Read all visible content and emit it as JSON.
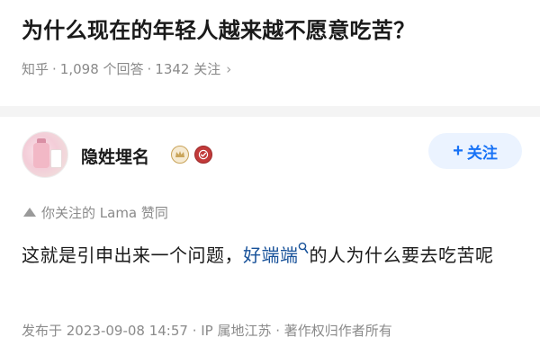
{
  "question": {
    "title": "为什么现在的年轻人越来越不愿意吃苦？",
    "source": "知乎",
    "answers": "1,098 个回答",
    "followers": "1342 关注",
    "sep": "·",
    "chevron": "›"
  },
  "answer": {
    "author": {
      "name": "隐姓埋名",
      "badges": [
        "crown-badge-icon",
        "verified-check-icon"
      ]
    },
    "follow_button": {
      "plus": "+",
      "label": "关注"
    },
    "voter_text": "你关注的 Lama 赞同",
    "content": {
      "part1": "这就是引申出来一个问题，",
      "link_text": "好端端",
      "part2": "的人为什么要去吃苦呢"
    },
    "publish_info": "发布于 2023-09-08 14:57 · IP 属地江苏 · 著作权归作者所有"
  },
  "colors": {
    "accent": "#1772f6",
    "link": "#175199",
    "meta_gray": "#8a8a8a",
    "badge_red": "#c23a3a",
    "badge_gold": "#c9a45a"
  }
}
